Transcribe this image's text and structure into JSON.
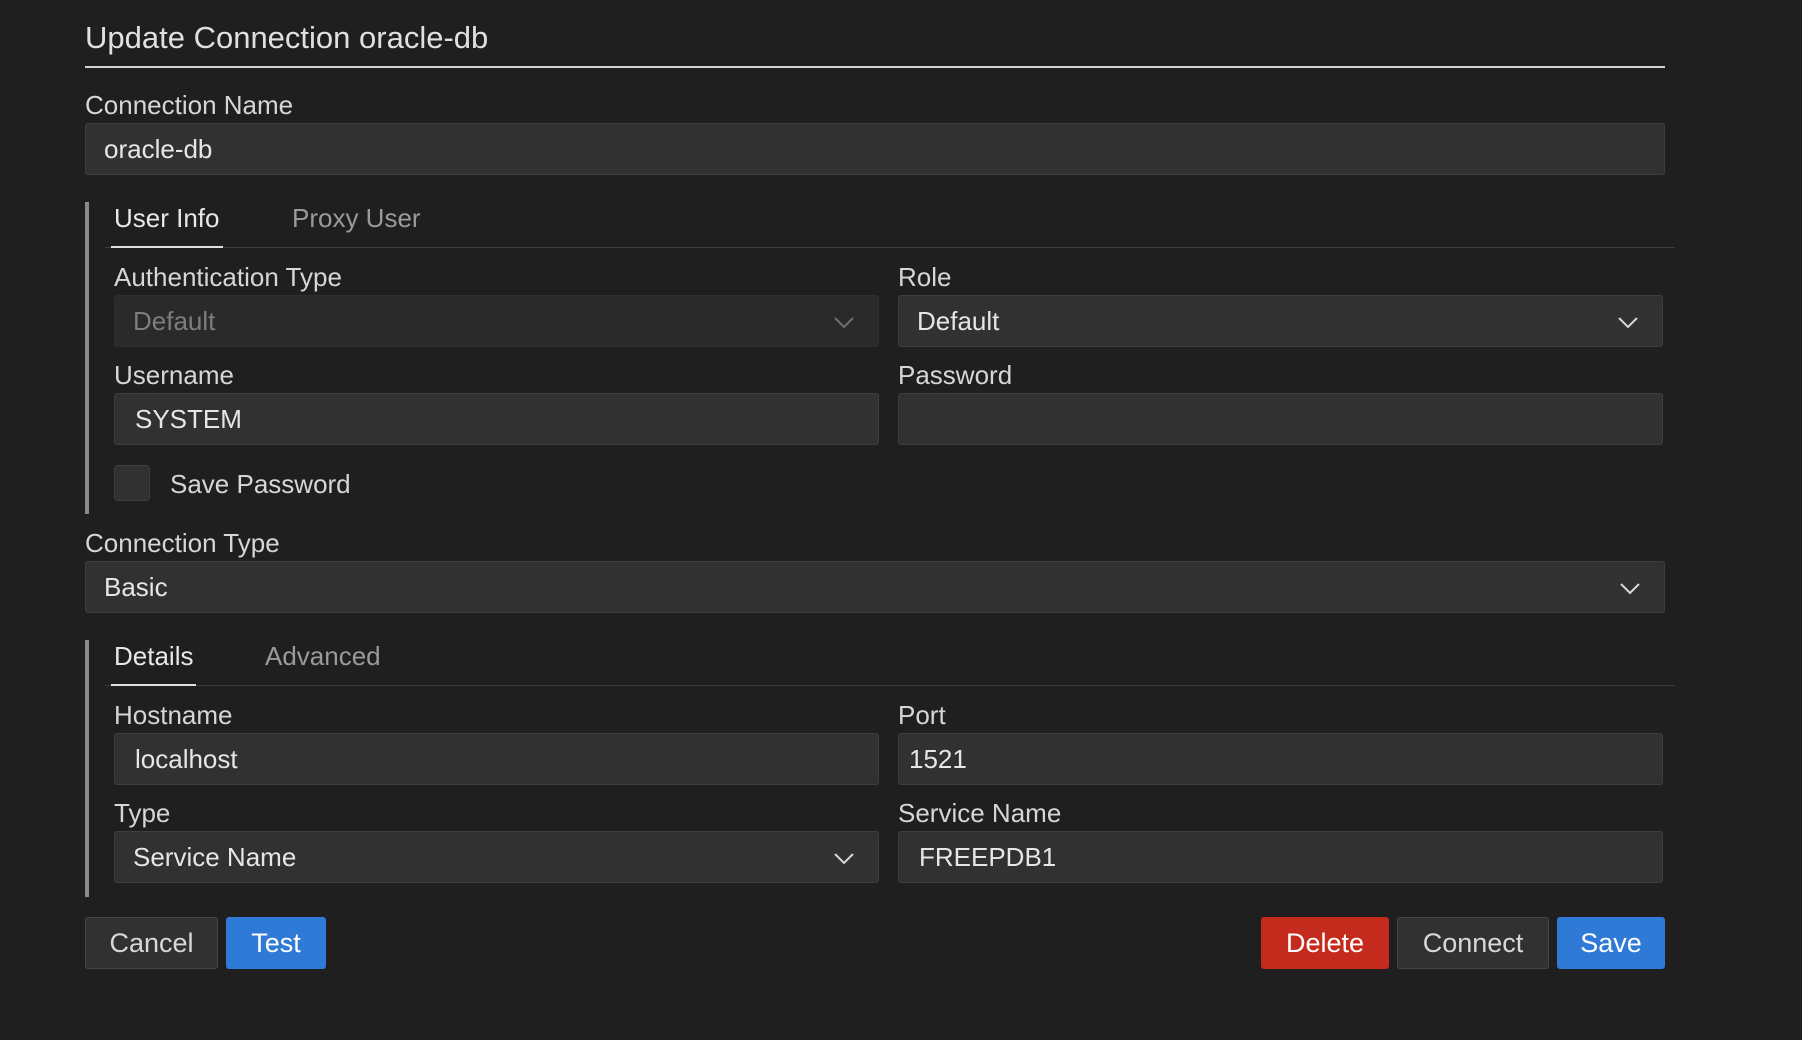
{
  "dialog": {
    "title": "Update Connection oracle-db"
  },
  "connection_name": {
    "label": "Connection Name",
    "value": "oracle-db"
  },
  "user_tabs": {
    "items": [
      {
        "label": "User Info",
        "active": true
      },
      {
        "label": "Proxy User",
        "active": false
      }
    ]
  },
  "auth_type": {
    "label": "Authentication Type",
    "value": "Default",
    "disabled": true
  },
  "role": {
    "label": "Role",
    "value": "Default"
  },
  "username": {
    "label": "Username",
    "value": "SYSTEM"
  },
  "password": {
    "label": "Password",
    "value": ""
  },
  "save_password": {
    "label": "Save Password",
    "checked": false
  },
  "connection_type": {
    "label": "Connection Type",
    "value": "Basic"
  },
  "detail_tabs": {
    "items": [
      {
        "label": "Details",
        "active": true
      },
      {
        "label": "Advanced",
        "active": false
      }
    ]
  },
  "hostname": {
    "label": "Hostname",
    "value": "localhost"
  },
  "port": {
    "label": "Port",
    "value": "1521"
  },
  "type": {
    "label": "Type",
    "value": "Service Name"
  },
  "service_name": {
    "label": "Service Name",
    "value": "FREEPDB1"
  },
  "buttons": {
    "cancel": "Cancel",
    "test": "Test",
    "delete": "Delete",
    "connect": "Connect",
    "save": "Save"
  },
  "colors": {
    "background": "#1f1f1f",
    "input": "#313131",
    "primary": "#2f7ad6",
    "danger": "#c42b1c"
  },
  "icons": {
    "dropdown": "chevron-down-icon"
  }
}
